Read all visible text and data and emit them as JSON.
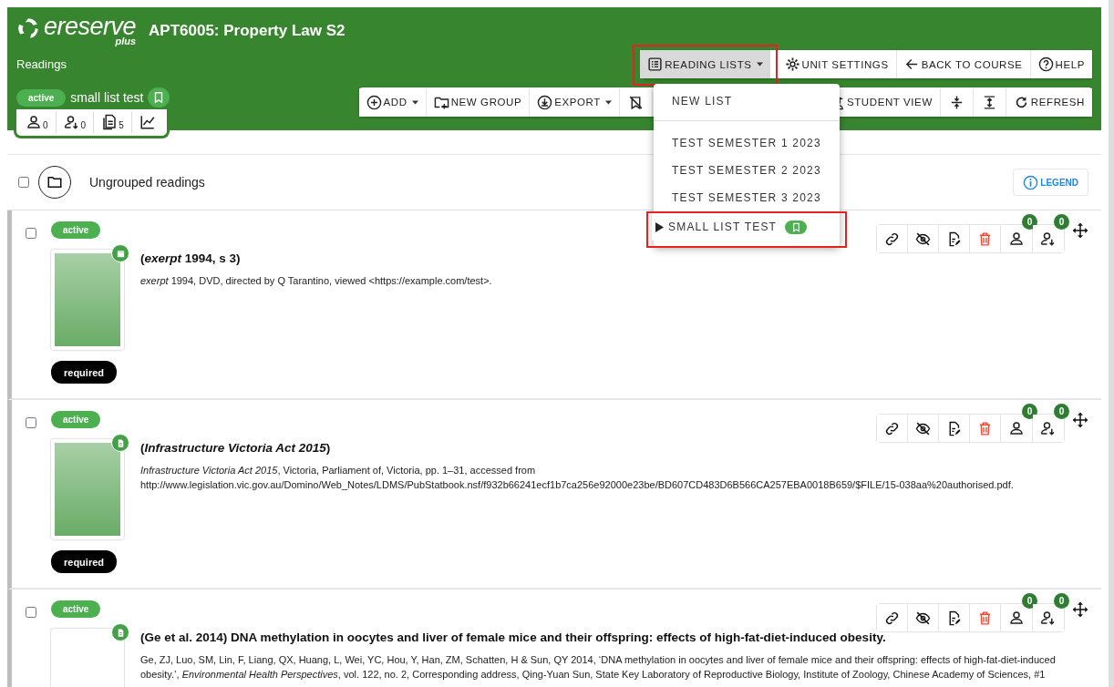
{
  "header": {
    "logo": {
      "word": "ereserve",
      "sub": "plus"
    },
    "title": "APT6005: Property Law S2",
    "section": "Readings"
  },
  "list": {
    "status": "active",
    "name": "small list test",
    "bookmarked": true,
    "stats": [
      {
        "kind": "students",
        "value": "0"
      },
      {
        "kind": "downloads",
        "value": "0"
      },
      {
        "kind": "readings",
        "value": "5"
      },
      {
        "kind": "chart"
      }
    ]
  },
  "top_toolbar": [
    {
      "kind": "list",
      "label": "READING LISTS",
      "dropdown": true,
      "expanded": true,
      "highlighted": true
    },
    {
      "kind": "settings",
      "label": "UNIT SETTINGS",
      "dropdown": false,
      "expanded": false,
      "highlighted": false
    },
    {
      "kind": "back",
      "label": "BACK TO COURSE",
      "dropdown": false,
      "expanded": false,
      "highlighted": false
    },
    {
      "kind": "help",
      "label": "HELP",
      "dropdown": false,
      "expanded": false,
      "highlighted": false
    }
  ],
  "toolbar": [
    {
      "kind": "add",
      "label": "ADD",
      "dropdown": true
    },
    {
      "kind": "new-group",
      "label": "NEW GROUP",
      "dropdown": false
    },
    {
      "kind": "export",
      "label": "EXPORT",
      "dropdown": true
    },
    {
      "kind": "bookmark-off"
    },
    {
      "kind": "student",
      "label": "STUDENT VIEW",
      "dropdown": false
    },
    {
      "kind": "collapse"
    },
    {
      "kind": "expand"
    },
    {
      "kind": "refresh",
      "label": "REFRESH",
      "dropdown": false
    }
  ],
  "menu": [
    {
      "kind": "action",
      "label": "NEW LIST",
      "current": false,
      "bookmarked": false,
      "highlighted": false
    },
    {
      "kind": "list",
      "label": "TEST SEMESTER 1 2023",
      "current": false,
      "bookmarked": false,
      "highlighted": false
    },
    {
      "kind": "list",
      "label": "TEST SEMESTER 2 2023",
      "current": false,
      "bookmarked": false,
      "highlighted": false
    },
    {
      "kind": "list",
      "label": "TEST SEMESTER 3 2023",
      "current": false,
      "bookmarked": false,
      "highlighted": false
    },
    {
      "kind": "list",
      "label": "SMALL LIST TEST",
      "current": true,
      "bookmarked": true,
      "highlighted": true
    }
  ],
  "group": {
    "label": "Ungrouped readings",
    "checked": false,
    "legend": "LEGEND"
  },
  "readings": [
    {
      "checked": false,
      "status": "active",
      "kind": "video",
      "cover": true,
      "title": "(*exerpt* 1994, s 3)",
      "citation": "*exerpt* 1994, DVD, directed by Q Tarantino, viewed <https://example.com/test>.",
      "tag": "required",
      "counts": [
        "0",
        "0"
      ]
    },
    {
      "checked": false,
      "status": "active",
      "kind": "document",
      "cover": true,
      "title": "(*Infrastructure Victoria Act 2015*)",
      "citation": "*Infrastructure Victoria Act 2015*, Victoria, Parliament of, Victoria, pp. 1–31, accessed from http://www.legislation.vic.gov.au/Domino/Web_Notes/LDMS/PubStatbook.nsf/f932b66241ecf1b7ca256e92000e23be/BD607CD483D6B566CA257EBA0018B659/$FILE/15-038aa%20authorised.pdf.",
      "tag": "required",
      "counts": [
        "0",
        "0"
      ]
    },
    {
      "checked": false,
      "status": "active",
      "kind": "document",
      "cover": false,
      "title": "(Ge et al. 2014) DNA methylation in oocytes and liver of female mice and their offspring: effects of high-fat-diet-induced obesity.",
      "citation": "Ge, ZJ, Luo, SM, Lin, F, Liang, QX, Huang, L, Wei, YC, Hou, Y, Han, ZM, Schatten, H & Sun, QY 2014, ‘DNA methylation in oocytes and liver of female mice and their offspring: effects of high-fat-diet-induced obesity.’, *Environmental Health Perspectives*, vol. 122, no. 2, Corresponding address, Qing-Yuan Sun, State Key Laboratory of Reproductive Biology, Institute of Zoology, Chinese Academy of Sciences, #1",
      "counts": [
        "0",
        "0"
      ]
    }
  ]
}
